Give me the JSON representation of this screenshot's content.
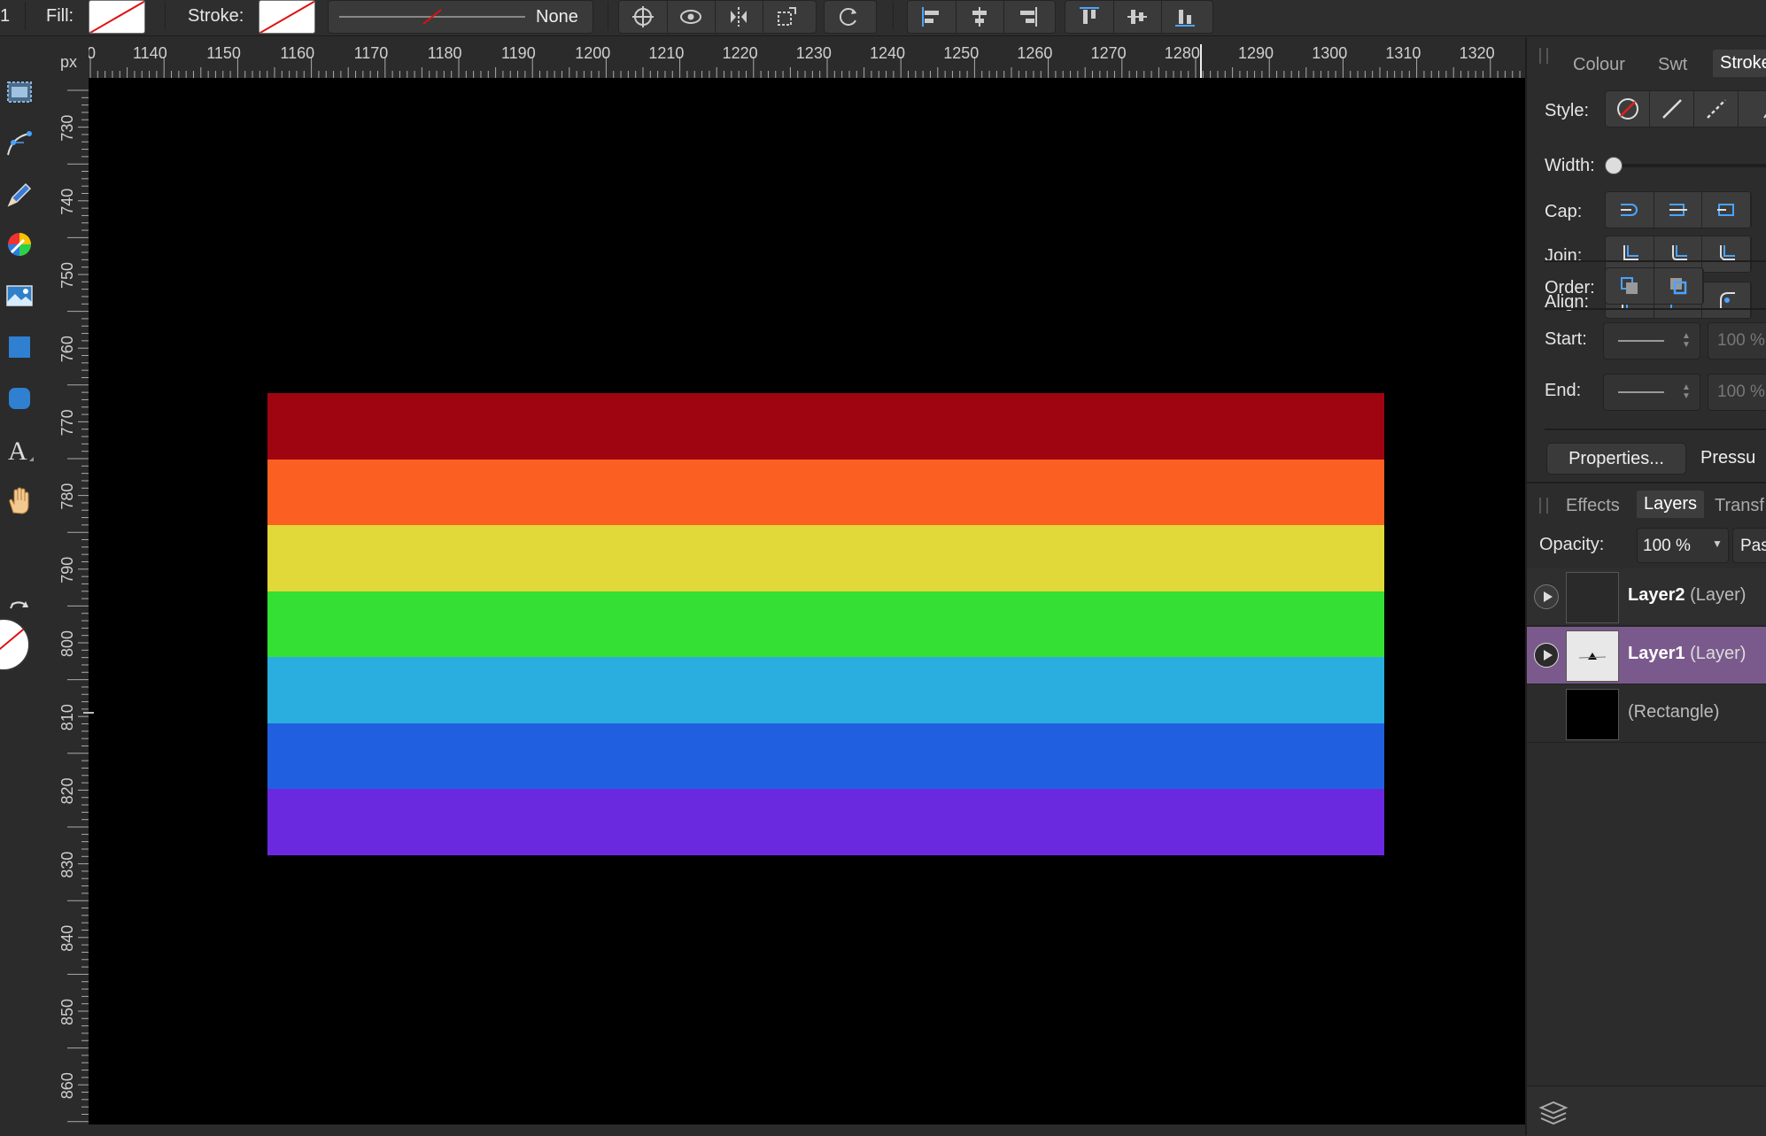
{
  "toolbar": {
    "leading_text": "1",
    "fill_label": "Fill:",
    "stroke_label": "Stroke:",
    "stroke_style_value": "None",
    "snap_icons": [
      "crosshair-icon",
      "eye-icon",
      "flip-icon",
      "transform-icon",
      "rotate-icon"
    ],
    "align_icons": [
      "align-left-icon",
      "align-center-icon",
      "align-right-icon",
      "align-top-icon",
      "align-middle-icon",
      "align-bottom-icon"
    ]
  },
  "ruler": {
    "unit": "px",
    "h_labels": [
      "0",
      "1140",
      "1150",
      "1160",
      "1170",
      "1180",
      "1190",
      "1200",
      "1210",
      "1220",
      "1230",
      "1240",
      "1250",
      "1260",
      "1270",
      "1280",
      "1290",
      "1300",
      "1310",
      "1320"
    ],
    "v_labels": [
      "730",
      "740",
      "750",
      "760",
      "770",
      "780",
      "790",
      "800",
      "810",
      "820",
      "830",
      "840",
      "850",
      "860"
    ]
  },
  "tools": [
    "artboard-tool-icon",
    "node-tool-icon",
    "pencil-tool-icon",
    "color-picker-icon",
    "image-tool-icon",
    "rectangle-tool-icon",
    "rounded-rectangle-tool-icon",
    "text-tool-icon",
    "hand-tool-icon"
  ],
  "canvas": {
    "stripes": [
      "#9e0511",
      "#fb6022",
      "#e1d839",
      "#34e033",
      "#2aaee0",
      "#2060e0",
      "#6a29df"
    ]
  },
  "stroke_panel": {
    "tabs": [
      "Colour",
      "Swt",
      "Stroke"
    ],
    "style_label": "Style:",
    "width_label": "Width:",
    "cap_label": "Cap:",
    "join_label": "Join:",
    "align_label": "Align:",
    "order_label": "Order:",
    "start_label": "Start:",
    "end_label": "End:",
    "start_pct": "100 %",
    "end_pct": "100 %",
    "properties_button": "Properties...",
    "pressure_button": "Pressu"
  },
  "layers_panel": {
    "tabs": [
      "Effects",
      "Layers",
      "Transf"
    ],
    "opacity_label": "Opacity:",
    "opacity_value": "100 %",
    "blend_mode": "Pass",
    "layers": [
      {
        "name": "Layer2",
        "type": "(Layer)"
      },
      {
        "name": "Layer1",
        "type": "(Layer)"
      },
      {
        "name": "",
        "type": "(Rectangle)"
      }
    ]
  }
}
